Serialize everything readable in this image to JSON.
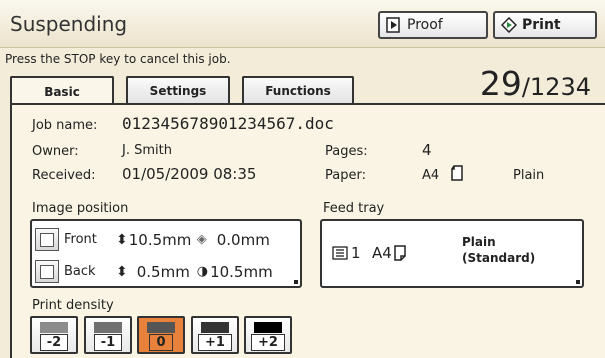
{
  "header": {
    "title": "Suspending",
    "proof_label": "Proof",
    "print_label": "Print"
  },
  "stop_message": "Press the STOP key to cancel this job.",
  "counter": {
    "current": "29",
    "total": "/1234"
  },
  "tabs": [
    {
      "label": "Basic",
      "active": true
    },
    {
      "label": "Settings",
      "active": false
    },
    {
      "label": "Functions",
      "active": false
    }
  ],
  "job": {
    "name_label": "Job name:",
    "name_value": "012345678901234567.doc",
    "owner_label": "Owner:",
    "owner_value": "J. Smith",
    "received_label": "Received:",
    "received_value": "01/05/2009 08:35",
    "pages_label": "Pages:",
    "pages_value": "4",
    "paper_label": "Paper:",
    "paper_size": "A4",
    "paper_type": "Plain"
  },
  "image_position": {
    "label": "Image position",
    "front_label": "Front",
    "front_vertical": "10.5mm",
    "front_horizontal": "0.0mm",
    "back_label": "Back",
    "back_vertical": "0.5mm",
    "back_horizontal": "10.5mm"
  },
  "feed_tray": {
    "label": "Feed tray",
    "tray_number": "1",
    "tray_size": "A4",
    "paper_type_line1": "Plain",
    "paper_type_line2": "(Standard)"
  },
  "print_density": {
    "label": "Print density",
    "levels": [
      {
        "label": "-2",
        "color": "#8c8c8c",
        "selected": false
      },
      {
        "label": "-1",
        "color": "#707070",
        "selected": false
      },
      {
        "label": "0",
        "color": "#555555",
        "selected": true
      },
      {
        "label": "+1",
        "color": "#333333",
        "selected": false
      },
      {
        "label": "+2",
        "color": "#000000",
        "selected": false
      }
    ]
  },
  "colors": {
    "background": "#f3ecd9",
    "selected": "#e8823a",
    "border": "#333333"
  }
}
